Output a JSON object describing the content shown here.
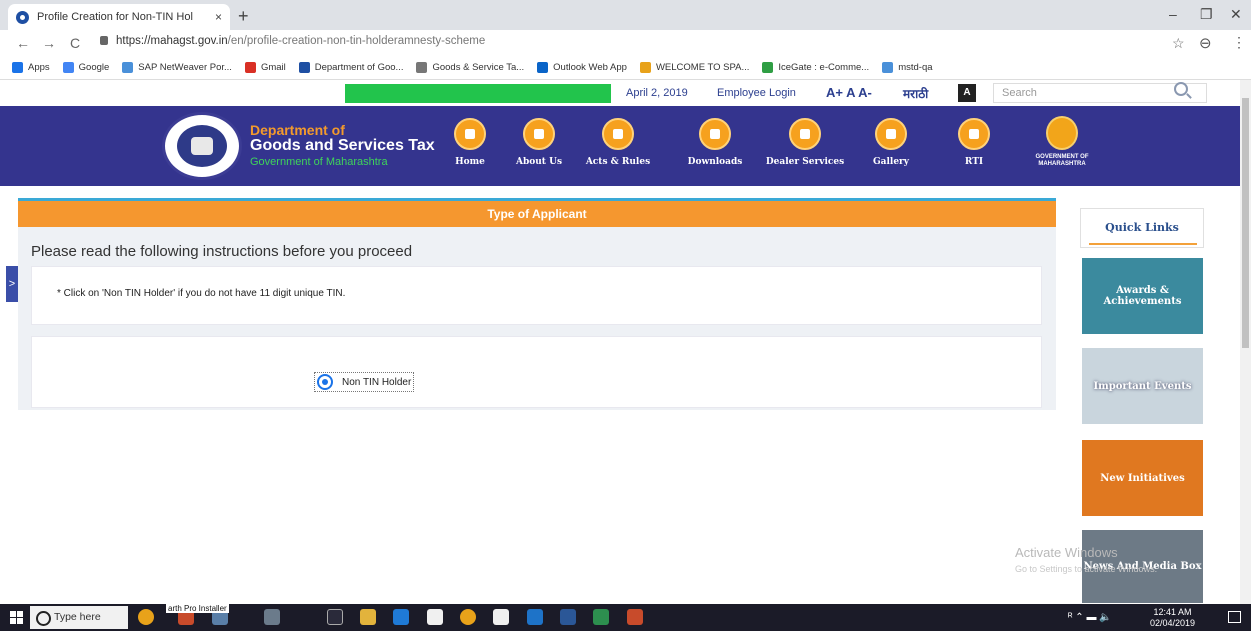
{
  "browser": {
    "tab_title": "Profile Creation for Non-TIN Hol",
    "tab_close": "×",
    "new_tab": "+",
    "url_host": "https://mahagst.gov.in",
    "url_path": "/en/profile-creation-non-tin-holderamnesty-scheme",
    "back": "←",
    "forward": "→",
    "reload": "C",
    "star": "☆",
    "menu": "⋮",
    "win_min": "–",
    "win_max": "❐",
    "win_close": "✕"
  },
  "bookmarks": [
    {
      "label": "Apps",
      "color": "#1a73e8"
    },
    {
      "label": "Google",
      "color": "#4285f4"
    },
    {
      "label": "SAP NetWeaver Por...",
      "color": "#4a90d9"
    },
    {
      "label": "Gmail",
      "color": "#d93025"
    },
    {
      "label": "Department of Goo...",
      "color": "#1e4fa3"
    },
    {
      "label": "Goods & Service Ta...",
      "color": "#777777"
    },
    {
      "label": "Outlook Web App",
      "color": "#0a64c8"
    },
    {
      "label": "WELCOME TO SPA...",
      "color": "#e8a21a"
    },
    {
      "label": "IceGate : e-Comme...",
      "color": "#2f9e44"
    },
    {
      "label": "mstd-qa",
      "color": "#4a90d9"
    }
  ],
  "topbar": {
    "date": "April 2, 2019",
    "employee_login": "Employee Login",
    "font_sizes": "A+ A A-",
    "language": "मराठी",
    "contrast": "A",
    "search_placeholder": "Search"
  },
  "header": {
    "dept_line1": "Department of",
    "dept_line2": "Goods and Services Tax",
    "dept_line3": "Government of Maharashtra",
    "nav": [
      "Home",
      "About Us",
      "Acts & Rules",
      "Downloads",
      "Dealer Services",
      "Gallery",
      "RTI"
    ],
    "gov_logo_text": "GOVERNMENT OF MAHARASHTRA"
  },
  "main": {
    "side_toggle": ">",
    "panel_title": "Type of Applicant",
    "instructions_title": "Please read the following instructions before you proceed",
    "instruction": "* Click on 'Non TIN Holder' if you do not have 11 digit unique TIN.",
    "radio_label": "Non TIN Holder"
  },
  "quick_links": {
    "title": "Quick Links",
    "tiles": [
      "Awards & Achievements",
      "Important Events",
      "New Initiatives",
      "News And Media Box"
    ]
  },
  "watermark": {
    "line1": "Activate Windows",
    "line2": "Go to Settings to activate Windows."
  },
  "taskbar": {
    "search_text": "Type here",
    "tooltip": "arth Pro Installer",
    "time": "12:41 AM",
    "date": "02/04/2019"
  }
}
